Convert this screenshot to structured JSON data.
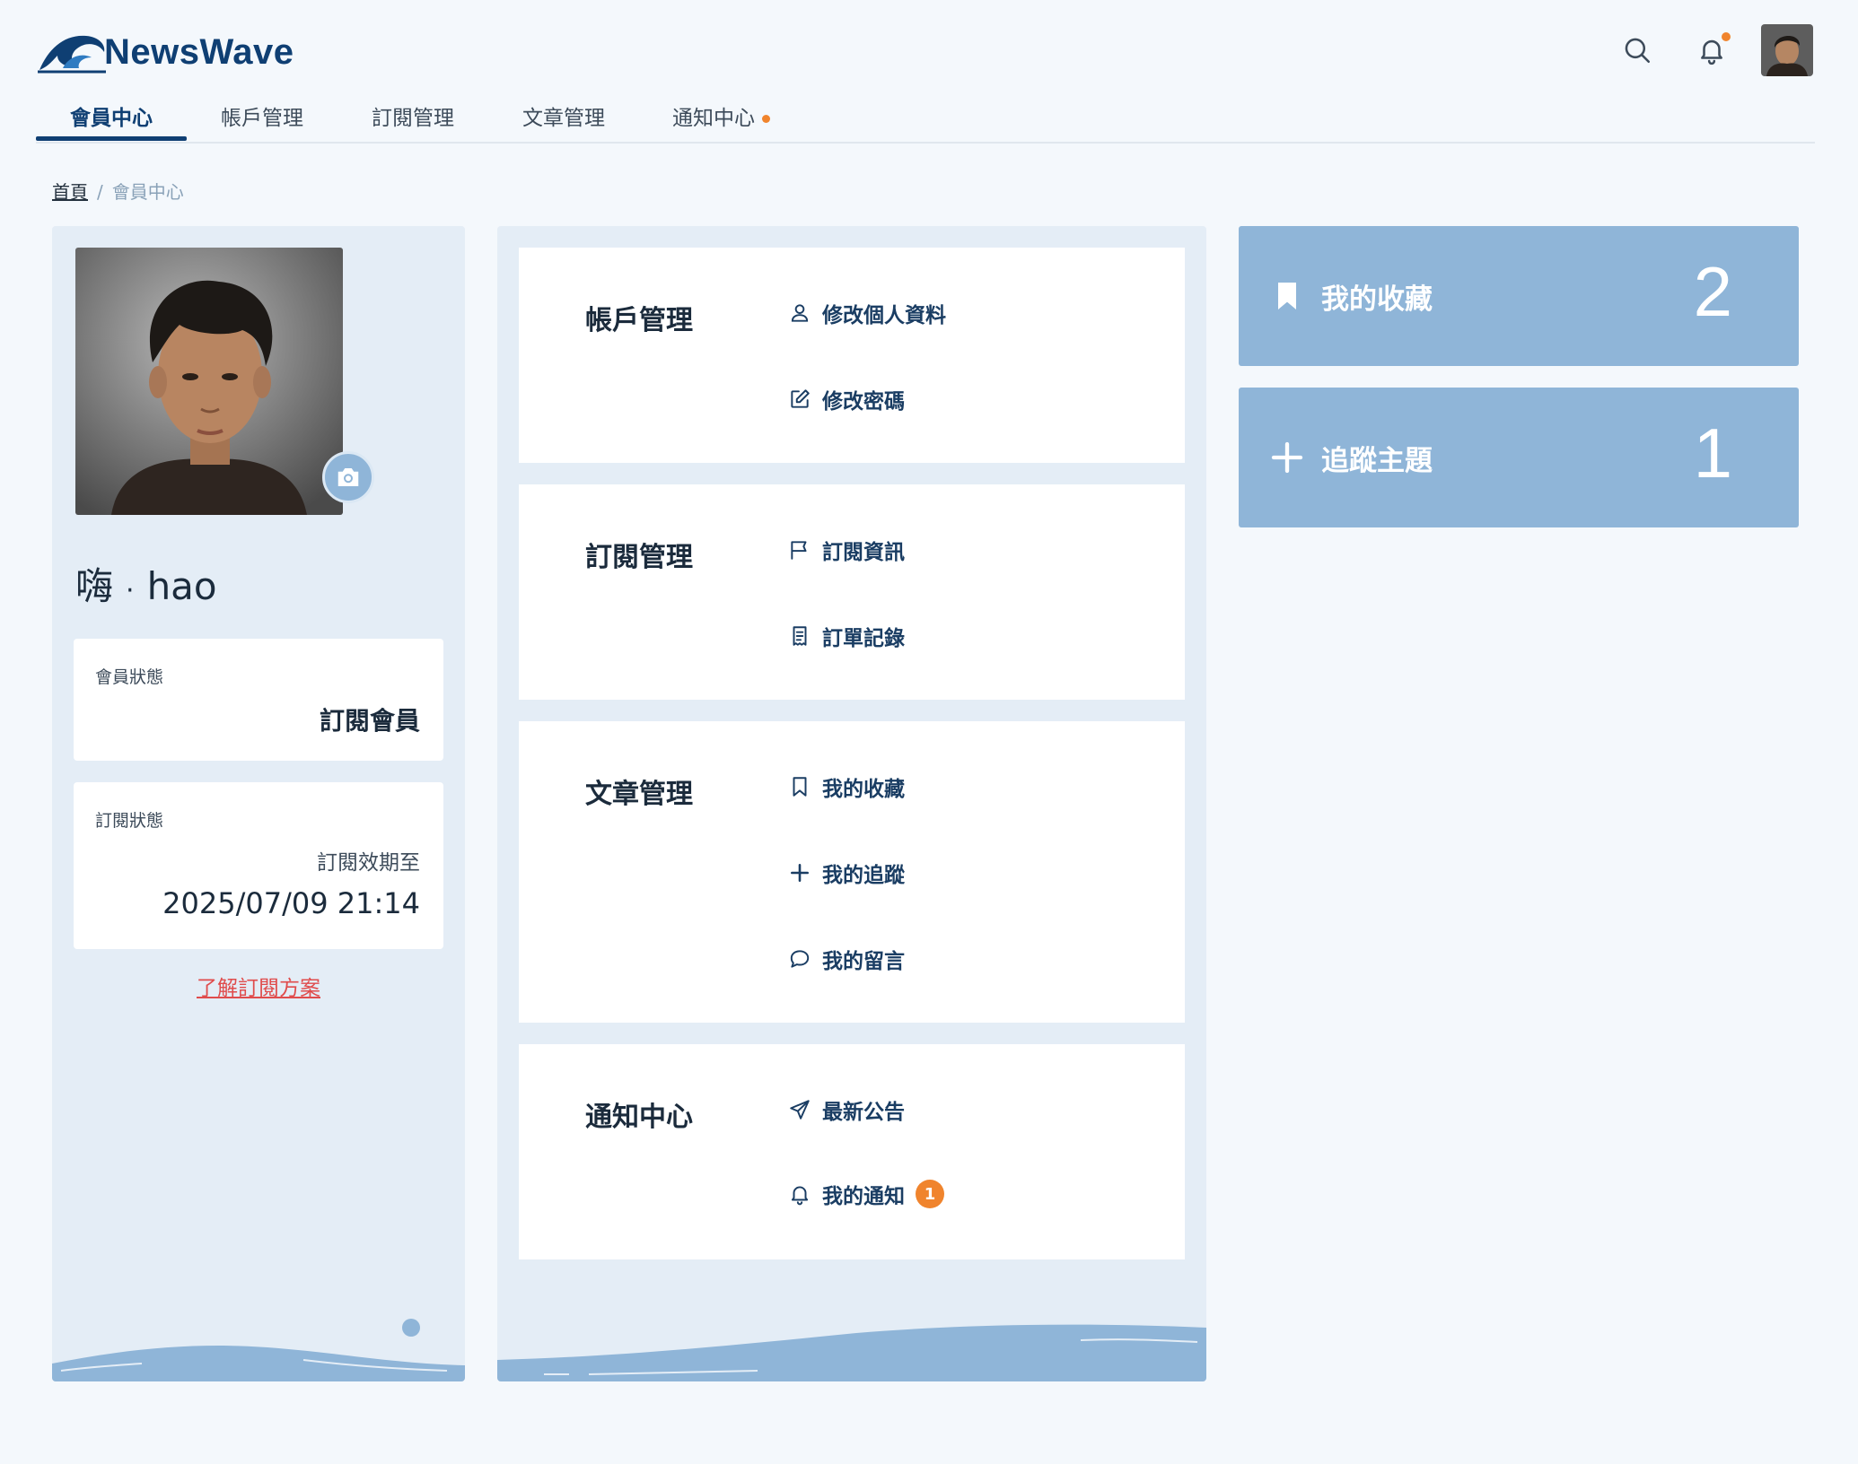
{
  "header": {
    "logo_text": "NewsWave",
    "icons": [
      "search-icon",
      "bell-icon",
      "user-avatar"
    ],
    "colors": {
      "brand": "#0f3f73",
      "accent": "#f0842d",
      "panel": "#e4edf6",
      "card": "#8fb5d8",
      "link": "#e04c4c"
    }
  },
  "nav": {
    "tabs": [
      {
        "label": "會員中心"
      },
      {
        "label": "帳戶管理"
      },
      {
        "label": "訂閱管理"
      },
      {
        "label": "文章管理"
      },
      {
        "label": "通知中心"
      }
    ]
  },
  "breadcrumb": {
    "home": "首頁",
    "separator": "/",
    "current": "會員中心"
  },
  "profile": {
    "greeting": "嗨",
    "greeting_dot": "·",
    "username": "hao",
    "member_status_label": "會員狀態",
    "member_status_value": "訂閱會員",
    "subscription_status_label": "訂閱狀態",
    "subscription_until_label": "訂閱效期至",
    "subscription_until_value": "2025/07/09 21:14",
    "plan_link": "了解訂閱方案"
  },
  "menu": {
    "sections": [
      {
        "title": "帳戶管理",
        "links": [
          {
            "label": "修改個人資料",
            "icon": "user-icon"
          },
          {
            "label": "修改密碼",
            "icon": "edit-icon"
          }
        ]
      },
      {
        "title": "訂閱管理",
        "links": [
          {
            "label": "訂閱資訊",
            "icon": "flag-icon"
          },
          {
            "label": "訂單記錄",
            "icon": "receipt-icon"
          }
        ]
      },
      {
        "title": "文章管理",
        "links": [
          {
            "label": "我的收藏",
            "icon": "bookmark-icon"
          },
          {
            "label": "我的追蹤",
            "icon": "plus-icon"
          },
          {
            "label": "我的留言",
            "icon": "comment-icon"
          }
        ]
      },
      {
        "title": "通知中心",
        "links": [
          {
            "label": "最新公告",
            "icon": "send-icon"
          },
          {
            "label": "我的通知",
            "icon": "bell-icon",
            "badge": "1"
          }
        ]
      }
    ]
  },
  "stats": [
    {
      "label": "我的收藏",
      "count": "2",
      "icon": "bookmark-icon"
    },
    {
      "label": "追蹤主題",
      "count": "1",
      "icon": "plus-icon"
    }
  ]
}
